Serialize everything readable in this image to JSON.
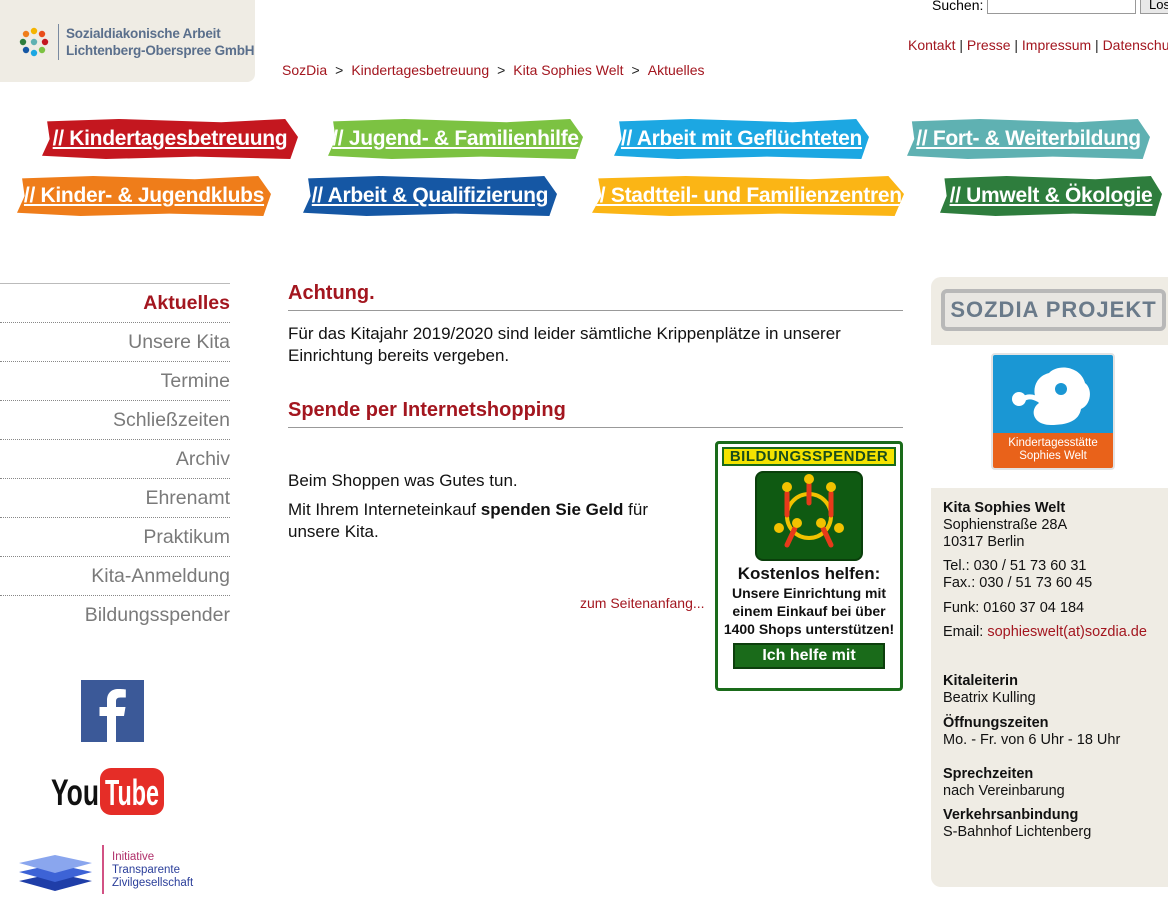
{
  "header": {
    "logo_line1": "Sozialdiakonische Arbeit",
    "logo_line2": "Lichtenberg-Oberspree GmbH",
    "search_label": "Suchen:",
    "search_value": "",
    "search_button": "Los",
    "top_links": [
      "Kontakt",
      "Presse",
      "Impressum",
      "Datenschut"
    ],
    "breadcrumb": [
      "SozDia",
      "Kindertagesbetreuung",
      "Kita Sophies Welt",
      "Aktuelles"
    ]
  },
  "banners": [
    {
      "label": "// Kindertagesbetreuung",
      "color": "#c4171f"
    },
    {
      "label": "// Jugend- & Familienhilfe",
      "color": "#7cc242"
    },
    {
      "label": "// Arbeit mit Geflüchteten",
      "color": "#1ca7e2"
    },
    {
      "label": "// Fort- & Weiterbildung",
      "color": "#5fb1b2"
    },
    {
      "label": "// Kinder- & Jugendklubs",
      "color": "#ef7d1a"
    },
    {
      "label": "// Arbeit & Qualifizierung",
      "color": "#1557a4"
    },
    {
      "label": "// Stadtteil- und Familienzentren",
      "color": "#fbb515"
    },
    {
      "label": "// Umwelt & Ökologie",
      "color": "#2e7d3d"
    }
  ],
  "nav": {
    "items": [
      "Aktuelles",
      "Unsere Kita",
      "Termine",
      "Schließzeiten",
      "Archiv",
      "Ehrenamt",
      "Praktikum",
      "Kita-Anmeldung",
      "Bildungsspender"
    ]
  },
  "social": {
    "youtube_you": "You",
    "youtube_tube": "Tube",
    "itz_line1": "Initiative",
    "itz_line2": "Transparente",
    "itz_line3": "Zivilgesellschaft"
  },
  "main": {
    "achtung_heading": "Achtung.",
    "achtung_text": "Für das Kitajahr 2019/2020 sind leider sämtliche Krippenplätze in unserer Einrichtung bereits vergeben.",
    "spende_heading": "Spende per Internetshopping",
    "shop_line1": "Beim Shoppen was Gutes tun.",
    "shop_line2_a": "Mit Ihrem Interneteinkauf ",
    "shop_line2_b": "spenden Sie Geld",
    "shop_line2_c": " für unsere Kita.",
    "top_link": "zum Seitenanfang...",
    "bs_title": "BILDUNGSSPENDER",
    "bs_headline": "Kostenlos helfen:",
    "bs_body": "Unsere Einrichtung mit einem Einkauf bei über 1400 Shops unterstützen!",
    "bs_button": "Ich helfe mit"
  },
  "sidebar": {
    "projekt_label": "SOZDIA PROJEKT",
    "kita_logo_line1": "Kindertagesstätte",
    "kita_logo_line2": "Sophies Welt",
    "name": "Kita Sophies Welt",
    "street": "Sophienstraße 28A",
    "city": "10317 Berlin",
    "tel": "Tel.: 030 / 51 73 60 31",
    "fax": "Fax.: 030 / 51 73 60 45",
    "funk": "Funk: 0160 37 04 184",
    "email_label": "Email: ",
    "email": "sophieswelt(at)sozdia.de",
    "leitung_label": "Kitaleiterin",
    "leitung": "Beatrix Kulling",
    "oeffnung_label": "Öffnungszeiten",
    "oeffnung": "Mo. - Fr. von 6 Uhr - 18 Uhr",
    "sprech_label": "Sprechzeiten",
    "sprech": "nach Vereinbarung",
    "verkehr_label": "Verkehrsanbindung",
    "verkehr": "S-Bahnhof Lichtenberg"
  },
  "colors": {
    "accent": "#a3161f",
    "panel": "#efece4"
  }
}
